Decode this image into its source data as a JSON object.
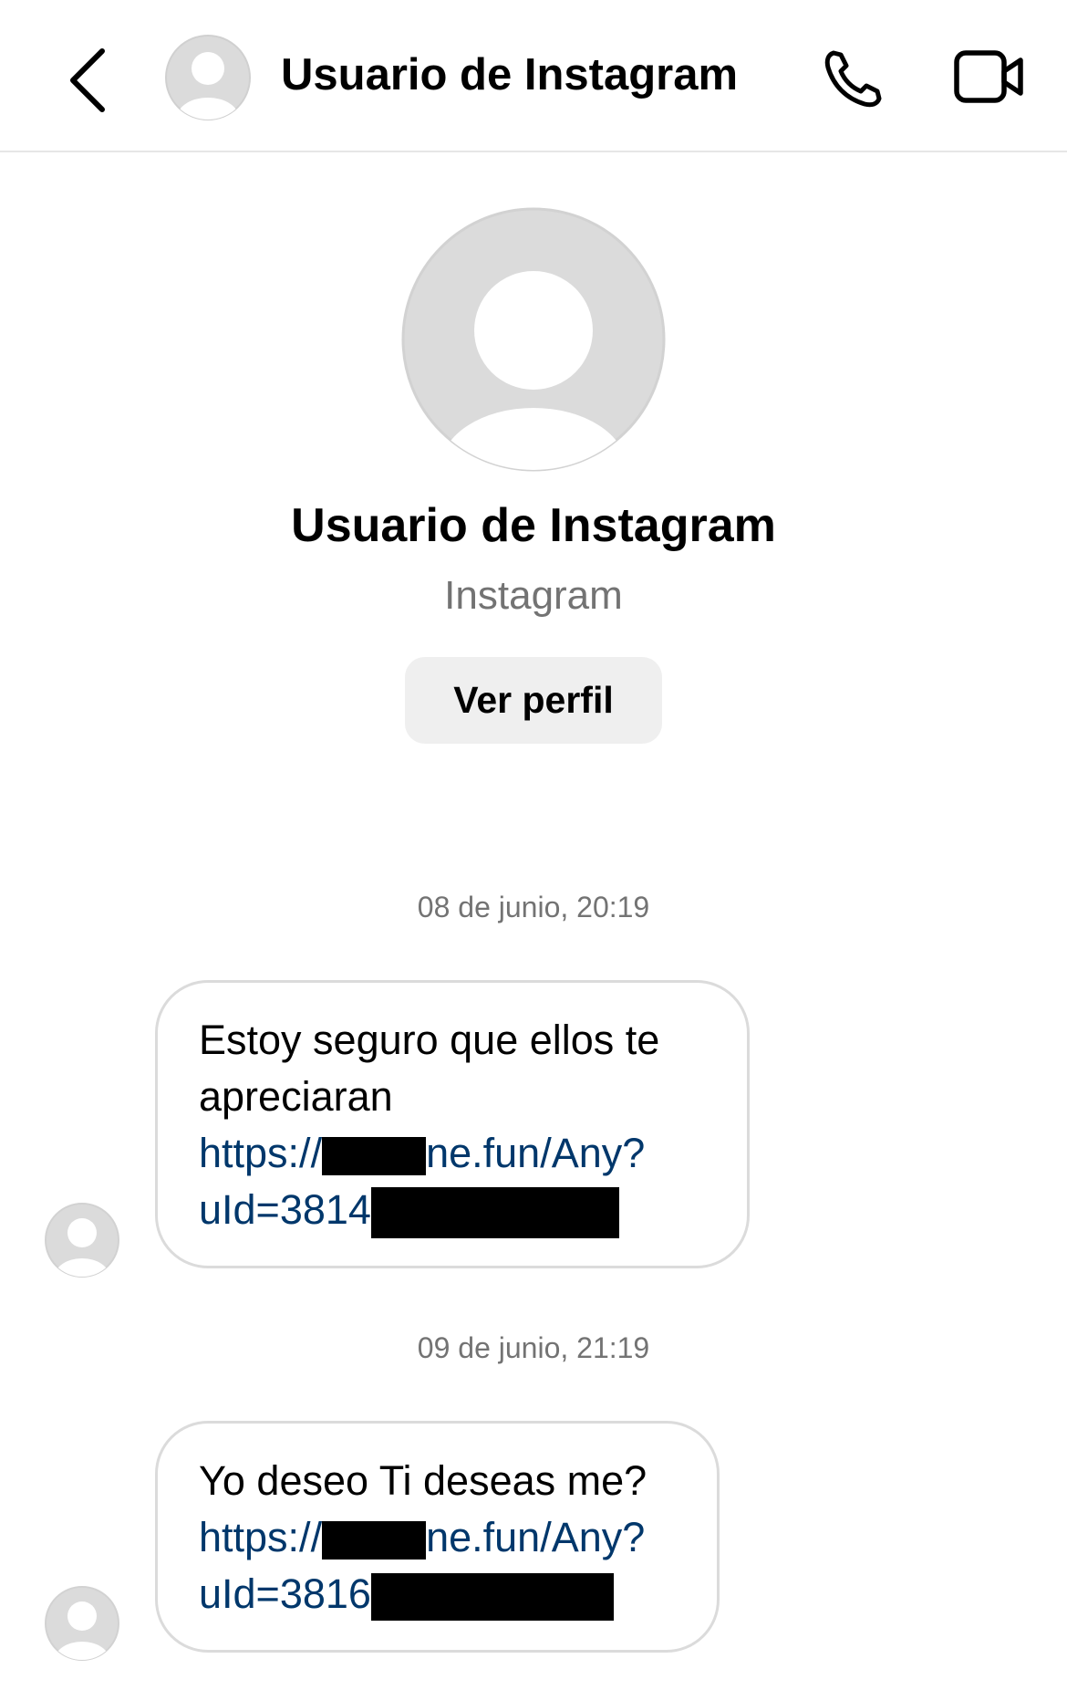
{
  "header": {
    "title": "Usuario de Instagram"
  },
  "profile": {
    "name": "Usuario de Instagram",
    "subtitle": "Instagram",
    "view_profile_label": "Ver perfil"
  },
  "messages": [
    {
      "timestamp": "08 de junio, 20:19",
      "text": "Estoy seguro que ellos te apreciaran",
      "link_line1_start": "https://",
      "link_line1_end": "ne.fun/Any?",
      "link_line2_start": "uId=3814"
    },
    {
      "timestamp": "09 de junio, 21:19",
      "text": "Yo deseo Ti deseas me?",
      "link_line1_start": "https://",
      "link_line1_end": "ne.fun/Any?",
      "link_line2_start": "uId=3816"
    }
  ],
  "colors": {
    "link": "#00376b",
    "secondary_text": "#737373",
    "button_bg": "#efefef",
    "avatar_gray": "#dbdbdb"
  },
  "icons": [
    "back-chevron-icon",
    "avatar-placeholder-icon",
    "phone-icon",
    "video-camera-icon"
  ]
}
